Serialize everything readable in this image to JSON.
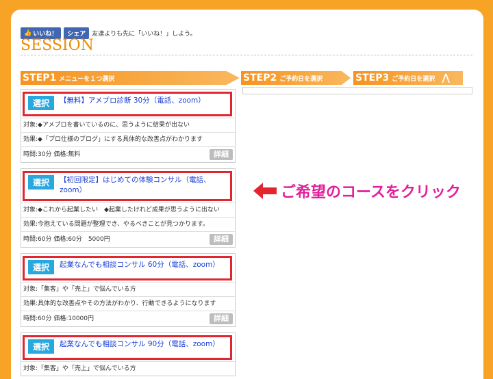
{
  "social": {
    "like_label": "いいね！",
    "share_label": "シェア",
    "text": "友達よりも先に「いいね！」しよう。"
  },
  "section_title": "SESSION",
  "steps": [
    {
      "num": "STEP1",
      "label": "メニューを１つ選択"
    },
    {
      "num": "STEP2",
      "label": "ご予約日を選択"
    },
    {
      "num": "STEP3",
      "label": "ご予約日を選択"
    }
  ],
  "select_label": "選択",
  "detail_label": "詳細",
  "courses": [
    {
      "name": "【無料】アメブロ診断 30分（電話、zoom）",
      "target": "対象:◆アメブロを書いているのに、思うように結果が出ない",
      "effect": "効果:◆「プロ仕様のブログ」にする具体的な改善点がわかります",
      "meta": "時間:30分 価格:無料"
    },
    {
      "name": "【初回限定】はじめての体験コンサル（電話、zoom）",
      "target": "対象:◆これから起業したい　◆起業したけれど成果が思うように出ない",
      "effect": "効果:今抱えている問題が整理でき、やるべきことが見つかります。",
      "meta": "時間:60分 価格:60分　5000円"
    },
    {
      "name": "起業なんでも相談コンサル 60分（電話、zoom）",
      "target": "対象:「集客」や「売上」で悩んでいる方",
      "effect": "効果:具体的な改善点やその方法がわかり、行動できるようになります",
      "meta": "時間:60分 価格:10000円"
    },
    {
      "name": "起業なんでも相談コンサル 90分（電話、zoom）",
      "target": "対象:「集客」や「売上」で悩んでいる方"
    }
  ],
  "callout": {
    "text": "ご希望のコースをクリック",
    "color": "#e2209b"
  },
  "colors": {
    "accent": "#f7a325",
    "select": "#29a8e0",
    "highlight": "#e2252f",
    "link": "#1a3fd6"
  }
}
